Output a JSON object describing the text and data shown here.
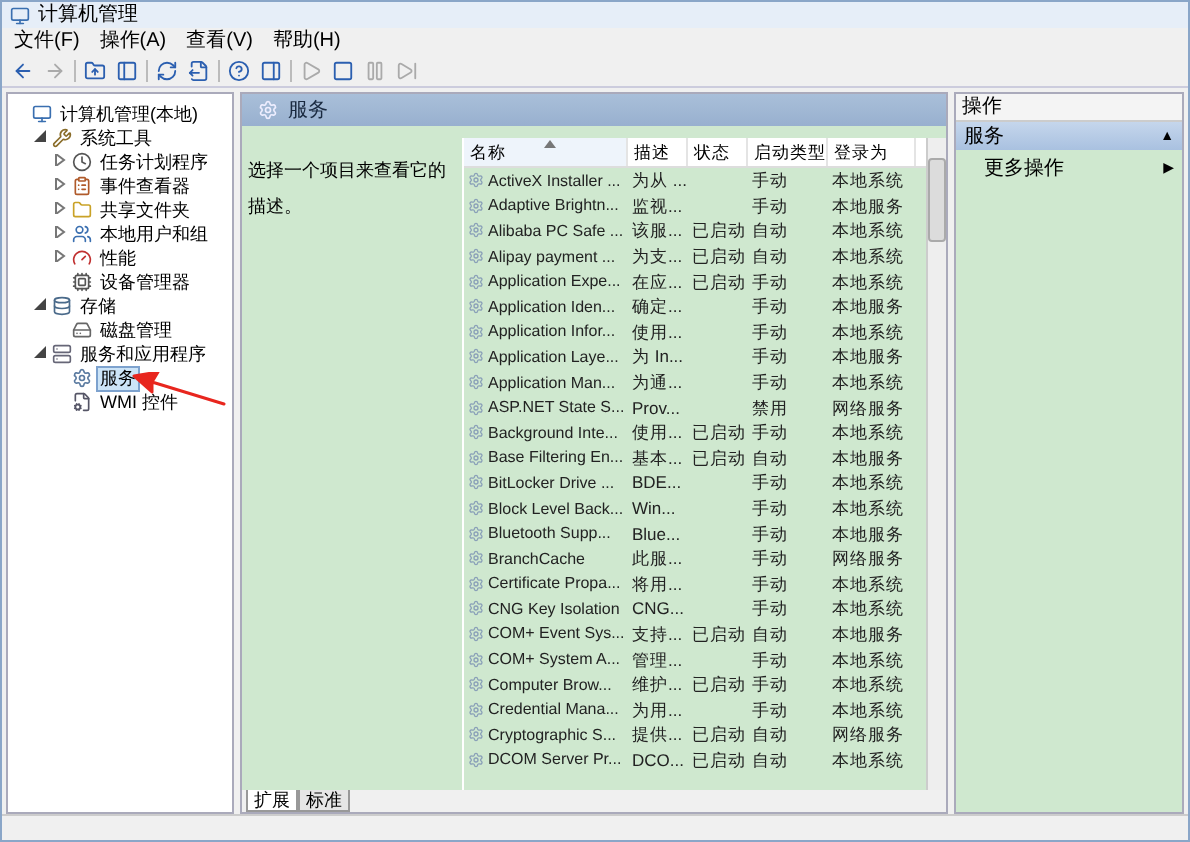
{
  "window": {
    "title": "计算机管理"
  },
  "menu": [
    "文件(F)",
    "操作(A)",
    "查看(V)",
    "帮助(H)"
  ],
  "toolbar": [
    {
      "kind": "back",
      "disabled": false
    },
    {
      "kind": "forward",
      "disabled": true
    },
    {
      "kind": "sep"
    },
    {
      "kind": "up",
      "disabled": false
    },
    {
      "kind": "tree",
      "disabled": false
    },
    {
      "kind": "sep"
    },
    {
      "kind": "refresh",
      "disabled": false
    },
    {
      "kind": "export",
      "disabled": false
    },
    {
      "kind": "sep"
    },
    {
      "kind": "help",
      "disabled": false
    },
    {
      "kind": "pane",
      "disabled": false
    },
    {
      "kind": "sep"
    },
    {
      "kind": "play",
      "disabled": true
    },
    {
      "kind": "stop",
      "disabled": false
    },
    {
      "kind": "pause",
      "disabled": true
    },
    {
      "kind": "restart",
      "disabled": true
    }
  ],
  "tree": [
    {
      "label": "计算机管理(本地)",
      "selected": false,
      "children": [
        {
          "label": "系统工具",
          "expanded": true,
          "selected": false,
          "children": [
            {
              "label": "任务计划程序",
              "expanded": false,
              "selected": false
            },
            {
              "label": "事件查看器",
              "expanded": false,
              "selected": false
            },
            {
              "label": "共享文件夹",
              "expanded": false,
              "selected": false
            },
            {
              "label": "本地用户和组",
              "expanded": false,
              "selected": false
            },
            {
              "label": "性能",
              "expanded": false,
              "selected": false
            },
            {
              "label": "设备管理器",
              "selected": false
            }
          ]
        },
        {
          "label": "存储",
          "expanded": true,
          "selected": false,
          "children": [
            {
              "label": "磁盘管理",
              "selected": false
            }
          ]
        },
        {
          "label": "服务和应用程序",
          "expanded": true,
          "selected": false,
          "children": [
            {
              "label": "服务",
              "selected": true
            },
            {
              "label": "WMI 控件",
              "selected": false
            }
          ]
        }
      ]
    }
  ],
  "center": {
    "title": "服务",
    "description": "选择一个项目来查看它的描述。",
    "columns": [
      {
        "label": "名称",
        "sorted": true
      },
      {
        "label": "描述",
        "sorted": false
      },
      {
        "label": "状态",
        "sorted": false
      },
      {
        "label": "启动类型",
        "sorted": false
      },
      {
        "label": "登录为",
        "sorted": false
      }
    ],
    "rows": [
      [
        "ActiveX Installer ...",
        "为从 ...",
        "",
        "手动",
        "本地系统"
      ],
      [
        "Adaptive Brightn...",
        "监视...",
        "",
        "手动",
        "本地服务"
      ],
      [
        "Alibaba PC Safe ...",
        "该服...",
        "已启动",
        "自动",
        "本地系统"
      ],
      [
        "Alipay payment ...",
        "为支...",
        "已启动",
        "自动",
        "本地系统"
      ],
      [
        "Application Expe...",
        "在应...",
        "已启动",
        "手动",
        "本地系统"
      ],
      [
        "Application Iden...",
        "确定...",
        "",
        "手动",
        "本地服务"
      ],
      [
        "Application Infor...",
        "使用...",
        "",
        "手动",
        "本地系统"
      ],
      [
        "Application Laye...",
        "为 In...",
        "",
        "手动",
        "本地服务"
      ],
      [
        "Application Man...",
        "为通...",
        "",
        "手动",
        "本地系统"
      ],
      [
        "ASP.NET State S...",
        "Prov...",
        "",
        "禁用",
        "网络服务"
      ],
      [
        "Background Inte...",
        "使用...",
        "已启动",
        "手动",
        "本地系统"
      ],
      [
        "Base Filtering En...",
        "基本...",
        "已启动",
        "自动",
        "本地服务"
      ],
      [
        "BitLocker Drive ...",
        "BDE...",
        "",
        "手动",
        "本地系统"
      ],
      [
        "Block Level Back...",
        "Win...",
        "",
        "手动",
        "本地系统"
      ],
      [
        "Bluetooth Supp...",
        "Blue...",
        "",
        "手动",
        "本地服务"
      ],
      [
        "BranchCache",
        "此服...",
        "",
        "手动",
        "网络服务"
      ],
      [
        "Certificate Propa...",
        "将用...",
        "",
        "手动",
        "本地系统"
      ],
      [
        "CNG Key Isolation",
        "CNG...",
        "",
        "手动",
        "本地系统"
      ],
      [
        "COM+ Event Sys...",
        "支持...",
        "已启动",
        "自动",
        "本地服务"
      ],
      [
        "COM+ System A...",
        "管理...",
        "",
        "手动",
        "本地系统"
      ],
      [
        "Computer Brow...",
        "维护...",
        "已启动",
        "手动",
        "本地系统"
      ],
      [
        "Credential Mana...",
        "为用...",
        "",
        "手动",
        "本地系统"
      ],
      [
        "Cryptographic S...",
        "提供...",
        "已启动",
        "自动",
        "网络服务"
      ],
      [
        "DCOM Server Pr...",
        "DCO...",
        "已启动",
        "自动",
        "本地系统"
      ]
    ],
    "tabs": [
      {
        "label": "扩展",
        "selected": true
      },
      {
        "label": "标准",
        "selected": false
      }
    ]
  },
  "actions": {
    "title": "操作",
    "section": {
      "label": "服务",
      "toggle": "▲"
    },
    "items": [
      {
        "label": "更多操作",
        "arrow": "▶"
      }
    ]
  }
}
